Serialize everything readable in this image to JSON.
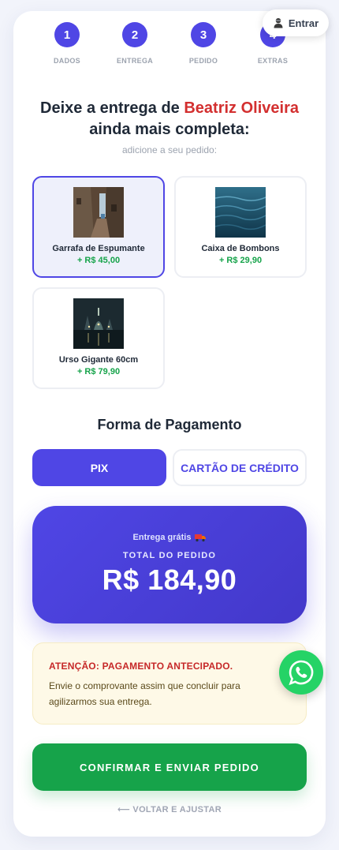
{
  "header": {
    "login_label": "Entrar",
    "login_icon": "user-icon"
  },
  "steps": [
    {
      "number": "1",
      "label": "DADOS"
    },
    {
      "number": "2",
      "label": "ENTREGA"
    },
    {
      "number": "3",
      "label": "PEDIDO"
    },
    {
      "number": "4",
      "label": "EXTRAS"
    }
  ],
  "headline": {
    "prefix": "Deixe a entrega de",
    "recipient": "Beatriz Oliveira",
    "suffix": "ainda mais completa:",
    "subtitle": "adicione a seu pedido:"
  },
  "products": [
    {
      "name": "Garrafa de Espumante",
      "price": "+ R$ 45,00",
      "selected": true,
      "image": "alley-photo"
    },
    {
      "name": "Caixa de Bombons",
      "price": "+ R$ 29,90",
      "selected": false,
      "image": "water-photo"
    },
    {
      "name": "Urso Gigante 60cm",
      "price": "+ R$ 79,90",
      "selected": false,
      "image": "night-city-photo"
    }
  ],
  "payment": {
    "title": "Forma de Pagamento",
    "options": [
      "PIX",
      "CARTÃO DE CRÉDITO"
    ],
    "selected": "PIX"
  },
  "summary": {
    "shipping_note": "Entrega grátis",
    "shipping_icon": "truck-icon",
    "total_label": "TOTAL DO PEDIDO",
    "total_value": "R$ 184,90"
  },
  "notice": {
    "title": "ATENÇÃO: PAGAMENTO ANTECIPADO.",
    "body": "Envie o comprovante assim que concluir para agilizarmos sua entrega."
  },
  "actions": {
    "confirm_label": "CONFIRMAR E ENVIAR PEDIDO",
    "back_label": "⟵ VOLTAR E AJUSTAR"
  },
  "fab": {
    "icon": "whatsapp-icon"
  },
  "colors": {
    "accent": "#4f46e5",
    "success": "#16a34a",
    "danger": "#d32f2f",
    "notice_bg": "#fef9e7",
    "whatsapp": "#25d366"
  }
}
